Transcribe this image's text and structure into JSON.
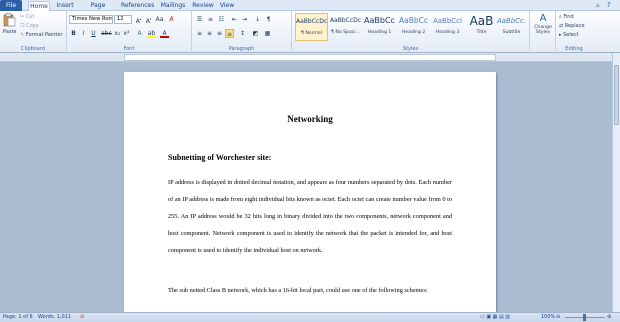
{
  "tabs": [
    "File",
    "Home",
    "Insert",
    "Page Layout",
    "References",
    "Mailings",
    "Review",
    "View"
  ],
  "active_tab": "Home",
  "clipboard": {
    "paste": "Paste",
    "cut": "Cut",
    "copy": "Copy",
    "format_painter": "Format Painter",
    "label": "Clipboard"
  },
  "font": {
    "name": "Times New Rom",
    "size": "12",
    "label": "Font"
  },
  "paragraph": {
    "label": "Paragraph"
  },
  "styles": {
    "items": [
      {
        "preview": "AaBbCcDc",
        "name": "¶ Normal",
        "selected": true
      },
      {
        "preview": "AaBbCcDc",
        "name": "¶ No Spaci..."
      },
      {
        "preview": "AaBbCc",
        "name": "Heading 1"
      },
      {
        "preview": "AaBbCc",
        "name": "Heading 2"
      },
      {
        "preview": "AaBbCcI",
        "name": "Heading 3"
      },
      {
        "preview": "AaB",
        "name": "Title"
      },
      {
        "preview": "AaBbCc.",
        "name": "Subtitle"
      }
    ],
    "change_styles": "Change Styles",
    "label": "Styles"
  },
  "editing": {
    "find": "Find",
    "replace": "Replace",
    "select": "Select",
    "label": "Editing"
  },
  "document": {
    "title": "Networking",
    "heading": "Subnetting of Worchester site:",
    "para1": "IP address is displayed in dotted decimal notation, and appears as four numbers separated by dots. Each number of an IP address is made from eight individual bits known as octet. Each octet can create number value from 0 to 255. An IP address would be 32 bits long in binary divided into the two components, network component and host component. Network component is used to identify the network that the packet is intended for, and host component is used to identify the individual host on network.",
    "para2": "The sub netted Class B network, which has a 16-bit local part, could use one of the following schemes:"
  },
  "status": {
    "page": "Page: 1 of 6",
    "words": "Words: 1,011",
    "zoom": "100%"
  },
  "colors": {
    "accent": "#2a5ea5",
    "ribbon_bg": "#e3ebf6",
    "doc_bg": "#abbbd0"
  }
}
